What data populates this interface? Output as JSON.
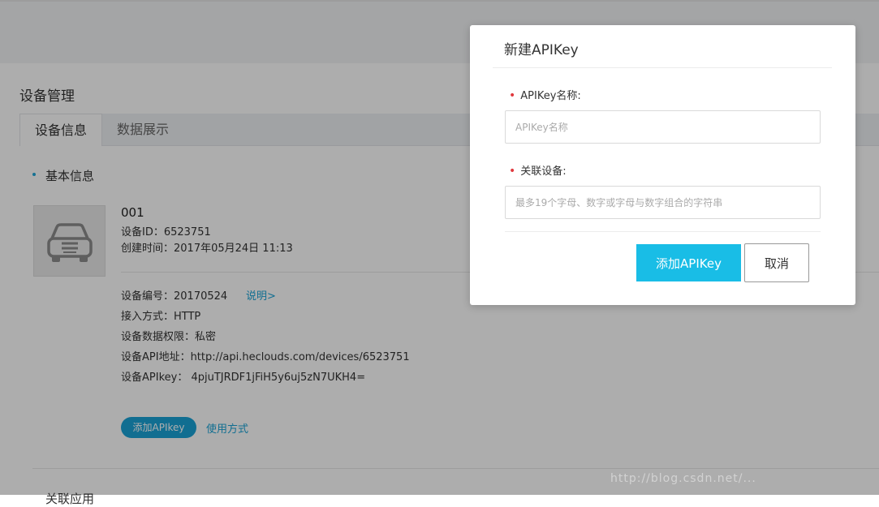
{
  "page": {
    "title": "设备管理",
    "tabs": [
      {
        "label": "设备信息",
        "active": true
      },
      {
        "label": "数据展示",
        "active": false
      }
    ],
    "section_title": "基本信息",
    "device": {
      "name": "001",
      "id_line": "设备ID：6523751",
      "created_line": "创建时间：2017年05月24日 11:13",
      "number_line": "设备编号：20170524",
      "explain_link": "说明>",
      "access_line": "接入方式：HTTP",
      "permission_line": "设备数据权限：私密",
      "api_address_line": "设备API地址：http://api.heclouds.com/devices/6523751",
      "api_key_line": "设备APIkey： 4pjuTJRDF1jFiH5y6uj5zN7UKH4="
    },
    "add_apikey_pill": "添加APIkey",
    "usage_link": "使用方式",
    "next_section_title": "关联应用"
  },
  "modal": {
    "title": "新建APIKey",
    "fields": [
      {
        "label": "APIKey名称:",
        "placeholder": "APIKey名称",
        "value": "",
        "required": true
      },
      {
        "label": "关联设备:",
        "placeholder": "最多19个字母、数字或字母与数字组合的字符串",
        "value": "",
        "required": true
      }
    ],
    "confirm_label": "添加APIKey",
    "cancel_label": "取消"
  },
  "watermark": "http://blog.csdn.net/...",
  "colors": {
    "accent": "#1aa3d6",
    "primary_button": "#19bde6",
    "required_star": "#e0393e",
    "overlay": "rgba(0,0,0,0.32)"
  },
  "icons": {
    "device_avatar": "car-icon"
  }
}
